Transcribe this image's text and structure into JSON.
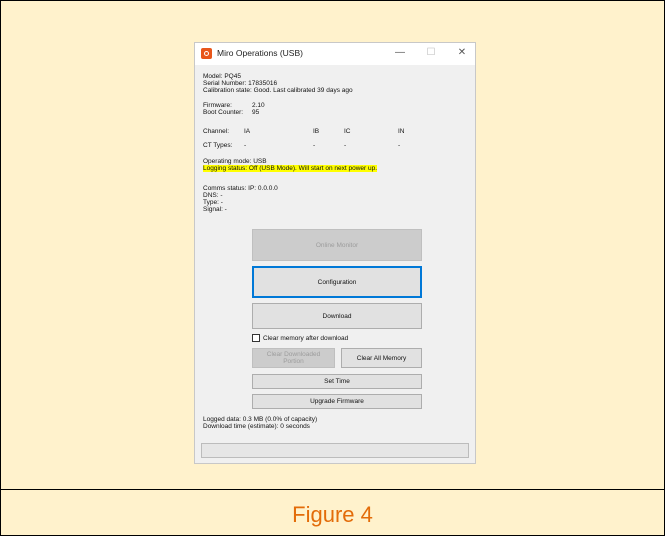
{
  "window": {
    "title": "Miro Operations (USB)",
    "controls": {
      "minimize": "—",
      "maximize": "☐",
      "close": "✕"
    }
  },
  "device": {
    "model": "Model: PQ45",
    "serial": "Serial Number: 17835016",
    "calibration": "Calibration state: Good. Last calibrated 39 days ago",
    "firmware_label": "Firmware:",
    "firmware_value": "2.10",
    "boot_label": "Boot Counter:",
    "boot_value": "95"
  },
  "channels": {
    "channel_label": "Channel:",
    "ct_label": "CT Types:",
    "names": [
      "IA",
      "IB",
      "IC",
      "IN"
    ],
    "ct_values": [
      "-",
      "-",
      "-",
      "-"
    ]
  },
  "mode": {
    "operating": "Operating mode: USB",
    "logging": "Logging status: Off (USB Mode). Will start on next power up."
  },
  "comms": {
    "status": "Comms status: IP: 0.0.0.0",
    "dns": "DNS: -",
    "type": "Type: -",
    "signal": "Signal: -"
  },
  "buttons": {
    "online_monitor": "Online Monitor",
    "configuration": "Configuration",
    "download": "Download",
    "clear_memory_checkbox": "Clear memory after download",
    "clear_downloaded": "Clear Downloaded Portion",
    "clear_all": "Clear All Memory",
    "set_time": "Set Time",
    "upgrade_firmware": "Upgrade Firmware"
  },
  "footer": {
    "logged_data": "Logged data: 0.3 MB (0.0% of capacity)",
    "download_time": "Download time (estimate): 0 seconds"
  },
  "caption": "Figure 4",
  "colors": {
    "panel_bg": "#fff2cc",
    "caption": "#e36c09",
    "highlight": "#ffff00",
    "focus": "#0078d7",
    "app_icon": "#e8561a"
  }
}
